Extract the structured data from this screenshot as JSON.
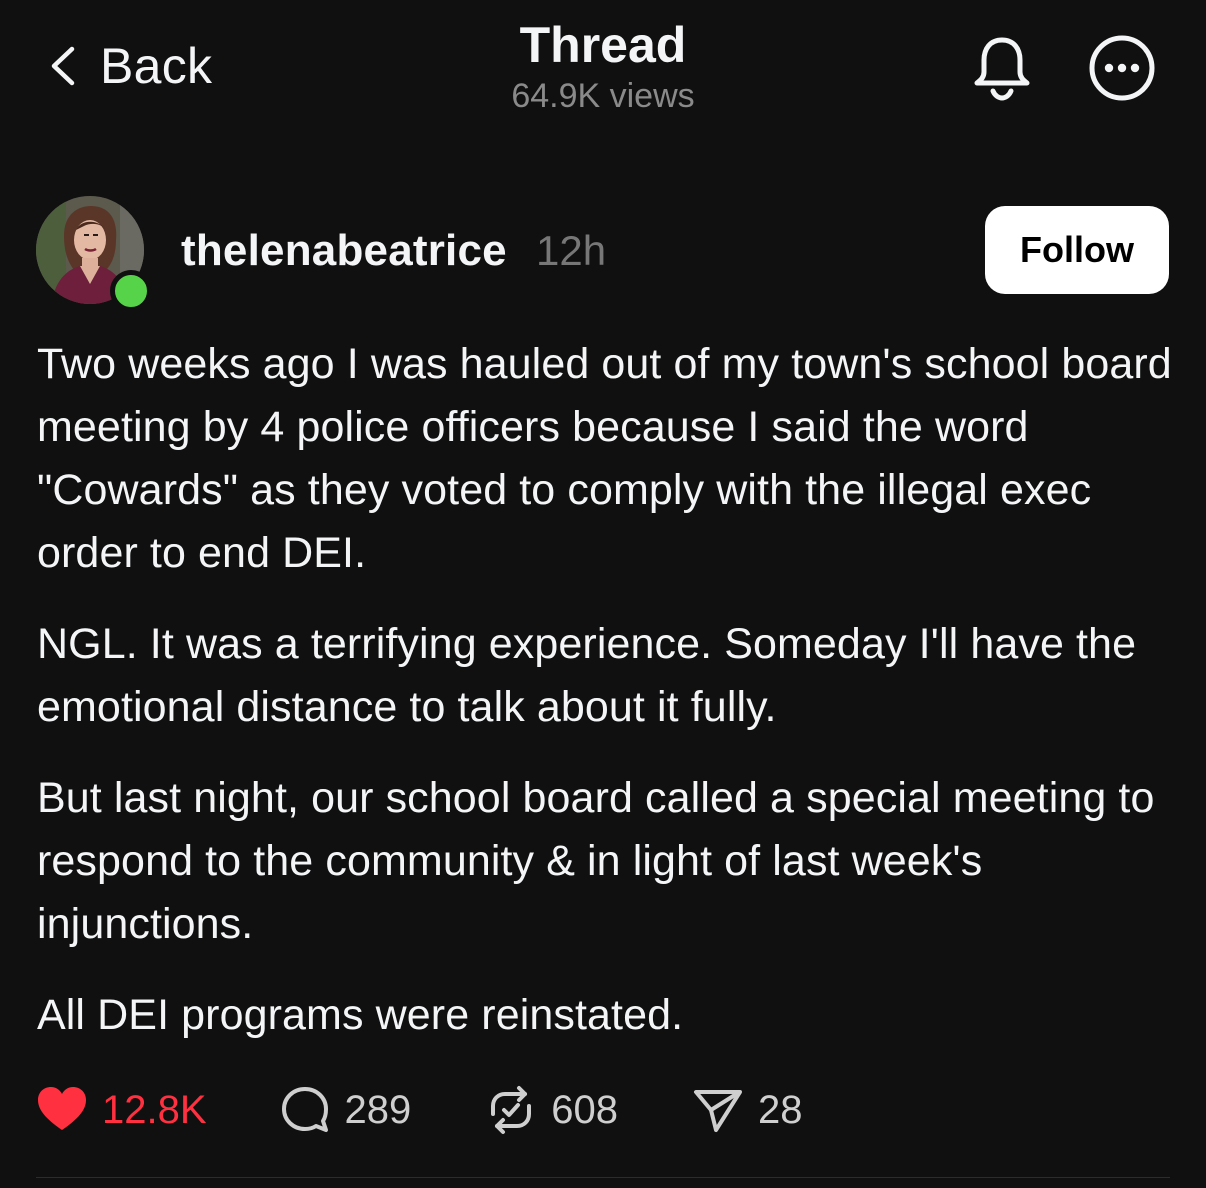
{
  "header": {
    "back_label": "Back",
    "title": "Thread",
    "views": "64.9K views",
    "icons": [
      "chevron-left-icon",
      "bell-icon",
      "more-icon"
    ]
  },
  "post": {
    "username": "thelenabeatrice",
    "time": "12h",
    "follow_label": "Follow",
    "online": true,
    "paragraphs": [
      "Two weeks ago I was hauled out of my town's school board meeting by 4 police officers because I said the word \"Cowards\" as they voted to comply with the illegal exec order to end DEI.",
      "NGL. It was a terrifying experience. Someday I'll have the emotional distance to talk about it fully.",
      "But last night, our school board called a special meeting to respond to the community & in light of last week's injunctions.",
      "All DEI programs were reinstated."
    ],
    "actions": {
      "likes": "12.8K",
      "replies": "289",
      "reposts": "608",
      "shares": "28"
    }
  },
  "colors": {
    "background": "#101010",
    "text": "#f3f5f7",
    "muted": "#8a8a8a",
    "like": "#ff3040",
    "online": "#57d349",
    "follow_bg": "#ffffff"
  }
}
